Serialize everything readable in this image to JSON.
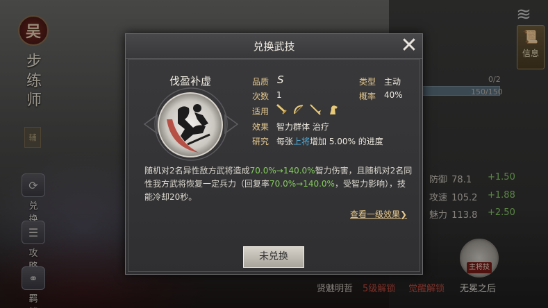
{
  "hero": {
    "faction_char": "吴",
    "class_name": "步练师",
    "role_tag": "辅"
  },
  "side_menu": [
    {
      "label": "兑换",
      "icon": "exchange-icon"
    },
    {
      "label": "攻略",
      "icon": "guide-icon"
    },
    {
      "label": "羁绊",
      "icon": "bond-icon"
    }
  ],
  "info_button": {
    "label": "信息",
    "icon": "scroll-icon"
  },
  "background_stats": {
    "count_top": "0/2",
    "count_bar": "150/150",
    "rows": [
      {
        "name": "防御",
        "value": "78.1",
        "bonus": "+1.50"
      },
      {
        "name": "攻速",
        "value": "105.2",
        "bonus": "+1.88"
      },
      {
        "name": "魅力",
        "value": "113.8",
        "bonus": "+2.50"
      }
    ],
    "bottom_labels": [
      "贤魅明哲",
      "5级解锁",
      "觉醒解锁",
      "无冕之后"
    ],
    "skill_tag": "主将技"
  },
  "modal": {
    "title": "兑换武技",
    "skill_name": "伐盈补虚",
    "fields": {
      "grade_label": "品质",
      "grade_value": "S",
      "type_label": "类型",
      "type_value": "主动",
      "count_label": "次数",
      "count_value": "1",
      "rate_label": "概率",
      "rate_value": "40%",
      "apply_label": "适用",
      "effect_label": "效果",
      "effect_value": "智力群体 治疗",
      "research_label": "研究",
      "research_pre": "每张",
      "research_hl": "上将",
      "research_post": "增加 5.00% 的进度"
    },
    "weapons": [
      "sword-icon",
      "bow-icon",
      "spear-icon",
      "horse-icon"
    ],
    "description": {
      "p1": "随机对2名异性敌方武将造成",
      "p1_green": "70.0%→140.0%",
      "p2": "智力伤害，且随机对2名同性我方武将恢复一定兵力（回复率",
      "p2_green": "70.0%→140.0%",
      "p3": "，受智力影响），技能冷却20秒。"
    },
    "more_link": "查看一级效果",
    "action_button": "未兑换"
  },
  "colors": {
    "field_label": "#e4c88e",
    "highlight_blue": "#4fb0e0",
    "highlight_green": "#84cc5c"
  }
}
